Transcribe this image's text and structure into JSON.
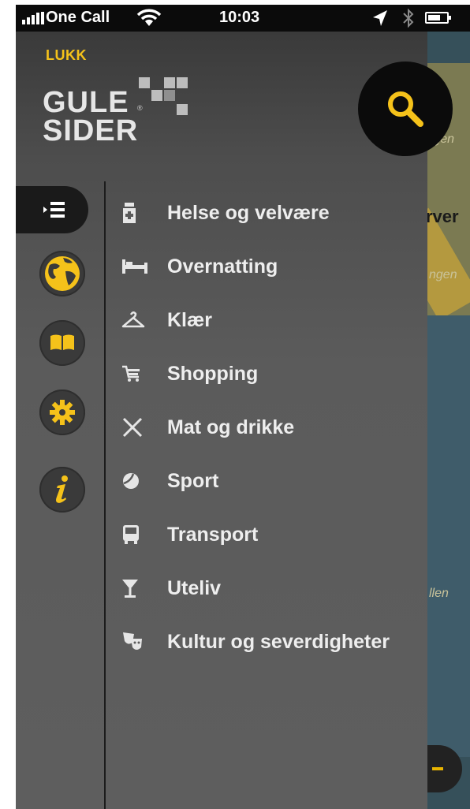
{
  "status_bar": {
    "carrier": "One Call",
    "time": "10:03"
  },
  "header": {
    "close_label": "LUKK",
    "logo_line1": "GULE",
    "logo_line2": "SIDER"
  },
  "map": {
    "labels": [
      "rgen",
      "rver",
      "ngen",
      "llen"
    ]
  },
  "categories": [
    {
      "label": "Helse og velvære",
      "icon": "medicine-bottle-icon"
    },
    {
      "label": "Overnatting",
      "icon": "bed-icon"
    },
    {
      "label": "Klær",
      "icon": "hanger-icon"
    },
    {
      "label": "Shopping",
      "icon": "shopping-cart-icon"
    },
    {
      "label": "Mat og drikke",
      "icon": "cutlery-icon"
    },
    {
      "label": "Sport",
      "icon": "ball-icon"
    },
    {
      "label": "Transport",
      "icon": "bus-icon"
    },
    {
      "label": "Uteliv",
      "icon": "cocktail-glass-icon"
    },
    {
      "label": "Kultur og severdigheter",
      "icon": "theater-masks-icon"
    }
  ],
  "rail": [
    "list-icon",
    "globe-icon",
    "book-icon",
    "gear-icon",
    "info-icon"
  ],
  "colors": {
    "accent": "#f5c21a",
    "drawer": "#5a5a5a",
    "text": "#eeeeee"
  }
}
